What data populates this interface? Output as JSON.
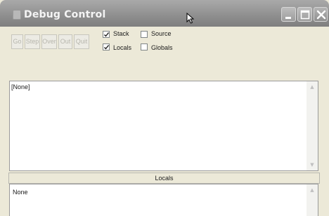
{
  "window": {
    "title": "Debug Control",
    "controls": {
      "minimize": "minimize-icon",
      "maximize": "maximize-icon",
      "close": "close-icon"
    }
  },
  "toolbar": {
    "buttons": [
      {
        "label": "Go",
        "enabled": false
      },
      {
        "label": "Step",
        "enabled": false
      },
      {
        "label": "Over",
        "enabled": false
      },
      {
        "label": "Out",
        "enabled": false
      },
      {
        "label": "Quit",
        "enabled": false
      }
    ],
    "checkboxes": {
      "stack": {
        "label": "Stack",
        "checked": true
      },
      "source": {
        "label": "Source",
        "checked": false
      },
      "locals": {
        "label": "Locals",
        "checked": true
      },
      "globals": {
        "label": "Globals",
        "checked": false
      }
    }
  },
  "stack_pane": {
    "text": "[None]"
  },
  "locals_pane": {
    "header": "Locals",
    "text": "None"
  },
  "colors": {
    "titlebar": "#8e8e8e",
    "window_bg": "#ece9d8",
    "disabled_text": "#b7b6ad"
  }
}
